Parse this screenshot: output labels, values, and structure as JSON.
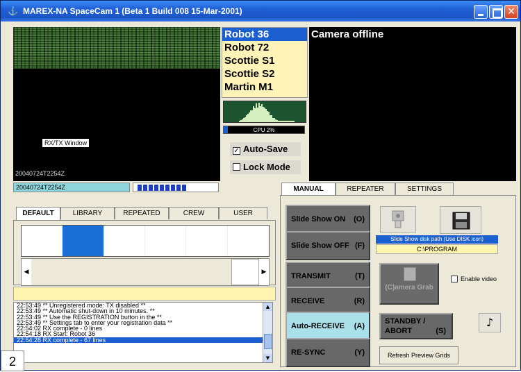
{
  "window": {
    "title": "MAREX-NA SpaceCam 1 (Beta 1 Build 008 15-Mar-2001)"
  },
  "rx": {
    "label": "RX/TX Window",
    "stamp": "20040724T2254Z"
  },
  "status": {
    "timestamp": "20040724T2254Z"
  },
  "modes": [
    "Robot 36",
    "Robot 72",
    "Scottie S1",
    "Scottie S2",
    "Martin M1"
  ],
  "cpu": {
    "label": "CPU 2%",
    "percent": 2
  },
  "options": {
    "auto_save": "Auto-Save",
    "auto_save_checked": true,
    "lock_mode": "Lock Mode",
    "lock_mode_checked": false
  },
  "camera": {
    "message": "Camera offline"
  },
  "right_tabs": [
    "MANUAL",
    "REPEATER",
    "SETTINGS"
  ],
  "left_tabs": [
    "DEFAULT",
    "LIBRARY",
    "REPEATED",
    "CREW",
    "USER"
  ],
  "slideshow": {
    "on_label": "Slide Show ON",
    "on_key": "(O)",
    "off_label": "Slide Show OFF",
    "off_key": "(F)",
    "path_label": "Slide Show disk path (Use DISK icon)",
    "path_value": "C:\\PROGRAM"
  },
  "controls": {
    "transmit": "TRANSMIT",
    "transmit_key": "(T)",
    "receive": "RECEIVE",
    "receive_key": "(R)",
    "auto_receive": "Auto-RECEIVE",
    "auto_receive_key": "(A)",
    "resync": "RE-SYNC",
    "resync_key": "(Y)",
    "camera_grab": "(C)amera Grab",
    "standby": "STANDBY / ABORT",
    "standby_key": "(S)",
    "enable_video": "Enable video",
    "refresh": "Refresh Preview Grids"
  },
  "log": [
    "22:53:49 ** Unregistered mode: TX disabled **",
    "22:53:49 ** Automatic shut-down in 10 minutes. **",
    "22:53:49 ** Use the REGISTRATION button in the **",
    "22:53:49 ** Settings tab to enter your registration data **",
    "22:54:02 RX complete - 0 lines",
    "22:54:18 RX Start: Robot 36",
    "22:54:28 RX complete - 67 lines"
  ],
  "figure_number": "2"
}
